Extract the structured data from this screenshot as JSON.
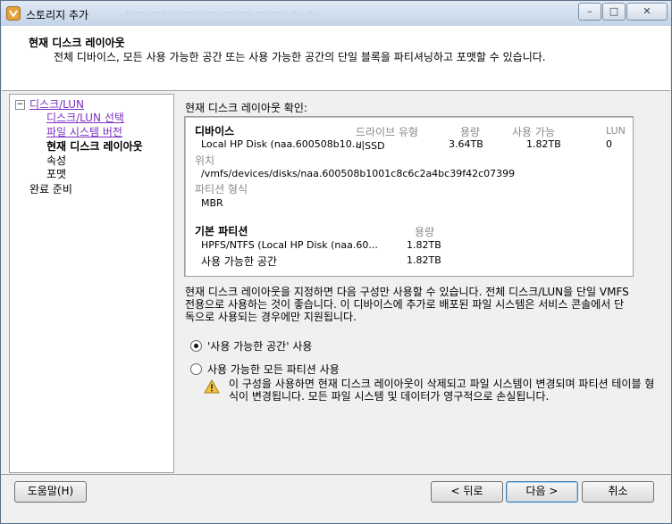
{
  "window": {
    "title": "스토리지 추가",
    "ghost_text": "······  ······  ·········  ······  ·········  ··········  ·· · ···",
    "minimize": "–",
    "maximize": "□",
    "close": "✕"
  },
  "header": {
    "title": "현재 디스크 레이아웃",
    "description": "전체 디바이스, 모든 사용 가능한 공간 또는 사용 가능한 공간의 단일 블록을 파티셔닝하고 포맷할 수 있습니다."
  },
  "nav": {
    "toggle": "−",
    "items": [
      {
        "label": "디스크/LUN"
      },
      {
        "label": "디스크/LUN 선택"
      },
      {
        "label": "파일 시스템 버전"
      },
      {
        "label": "현재 디스크 레이아웃"
      },
      {
        "label": "속성"
      },
      {
        "label": "포맷"
      },
      {
        "label": "완료 준비"
      }
    ]
  },
  "main": {
    "confirm_label": "현재 디스크 레이아웃 확인:",
    "device_heading": "디바이스",
    "columns": {
      "drive_type": "드라이브 유형",
      "capacity": "용량",
      "available": "사용 가능",
      "lun": "LUN"
    },
    "device": {
      "name": "Local HP Disk (naa.600508b10...",
      "drive_type": "비SSD",
      "capacity": "3.64TB",
      "available": "1.82TB",
      "lun": "0"
    },
    "location_label": "위치",
    "location_value": "/vmfs/devices/disks/naa.600508b1001c8c6c2a4bc39f42c07399",
    "partition_format_label": "파티션 형식",
    "partition_format_value": "MBR",
    "primary_partitions_heading": "기본 파티션",
    "partition_capacity_header": "용량",
    "partitions": [
      {
        "name": "HPFS/NTFS (Local HP Disk (naa.60...",
        "capacity": "1.82TB"
      },
      {
        "name": "사용 가능한 공간",
        "capacity": "1.82TB"
      }
    ],
    "info_text": "현재 디스크 레이아웃을 지정하면 다음 구성만 사용할 수 있습니다. 전체 디스크/LUN을 단일 VMFS 전용으로 사용하는 것이 좋습니다. 이 디바이스에 추가로 배포된 파일 시스템은 서비스 콘솔에서 단독으로 사용되는 경우에만 지원됩니다.",
    "option_free_space": "'사용 가능한 공간' 사용",
    "option_all_partitions": "사용 가능한 모든 파티션 사용",
    "warning_text": "이 구성을 사용하면 현재 디스크 레이아웃이 삭제되고 파일 시스템이 변경되며 파티션 테이블 형식이 변경됩니다. 모든 파일 시스템 및 데이터가 영구적으로 손실됩니다."
  },
  "footer": {
    "help": "도움말(H)",
    "back": "< 뒤로",
    "next": "다음 >",
    "cancel": "취소"
  }
}
